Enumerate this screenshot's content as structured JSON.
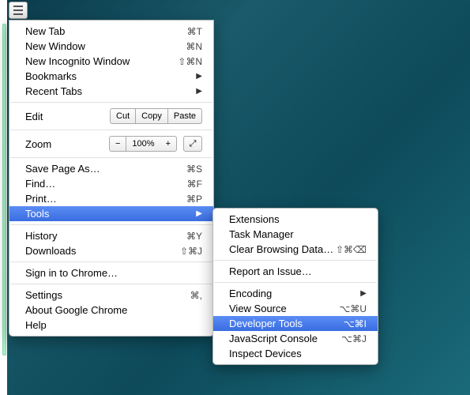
{
  "mainMenu": {
    "groups": [
      [
        {
          "id": "new-tab",
          "label": "New Tab",
          "shortcut": "⌘T"
        },
        {
          "id": "new-window",
          "label": "New Window",
          "shortcut": "⌘N"
        },
        {
          "id": "new-incognito",
          "label": "New Incognito Window",
          "shortcut": "⇧⌘N"
        },
        {
          "id": "bookmarks",
          "label": "Bookmarks",
          "submenu": true
        },
        {
          "id": "recent-tabs",
          "label": "Recent Tabs",
          "submenu": true
        }
      ],
      [
        {
          "id": "edit",
          "type": "edit-row",
          "label": "Edit",
          "buttons": [
            "Cut",
            "Copy",
            "Paste"
          ]
        }
      ],
      [
        {
          "id": "zoom",
          "type": "zoom-row",
          "label": "Zoom",
          "minus": "−",
          "plus": "+",
          "pct": "100%",
          "fullscreen": "⤢"
        }
      ],
      [
        {
          "id": "save-as",
          "label": "Save Page As…",
          "shortcut": "⌘S"
        },
        {
          "id": "find",
          "label": "Find…",
          "shortcut": "⌘F"
        },
        {
          "id": "print",
          "label": "Print…",
          "shortcut": "⌘P"
        },
        {
          "id": "tools",
          "label": "Tools",
          "submenu": true,
          "highlight": true
        }
      ],
      [
        {
          "id": "history",
          "label": "History",
          "shortcut": "⌘Y"
        },
        {
          "id": "downloads",
          "label": "Downloads",
          "shortcut": "⇧⌘J"
        }
      ],
      [
        {
          "id": "signin",
          "label": "Sign in to Chrome…"
        }
      ],
      [
        {
          "id": "settings",
          "label": "Settings",
          "shortcut": "⌘,"
        },
        {
          "id": "about",
          "label": "About Google Chrome"
        },
        {
          "id": "help",
          "label": "Help"
        }
      ]
    ]
  },
  "subMenu": {
    "groups": [
      [
        {
          "id": "extensions",
          "label": "Extensions"
        },
        {
          "id": "task-manager",
          "label": "Task Manager"
        },
        {
          "id": "clear-browsing",
          "label": "Clear Browsing Data…",
          "shortcut": "⇧⌘⌫"
        }
      ],
      [
        {
          "id": "report-issue",
          "label": "Report an Issue…"
        }
      ],
      [
        {
          "id": "encoding",
          "label": "Encoding",
          "submenu": true
        },
        {
          "id": "view-source",
          "label": "View Source",
          "shortcut": "⌥⌘U"
        },
        {
          "id": "dev-tools",
          "label": "Developer Tools",
          "shortcut": "⌥⌘I",
          "highlight": true
        },
        {
          "id": "js-console",
          "label": "JavaScript Console",
          "shortcut": "⌥⌘J"
        },
        {
          "id": "inspect-devices",
          "label": "Inspect Devices"
        }
      ]
    ]
  }
}
